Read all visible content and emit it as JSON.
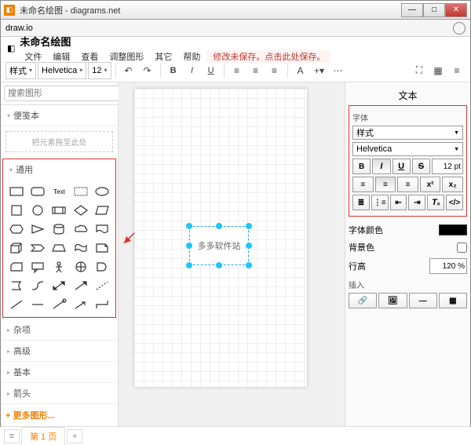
{
  "window": {
    "title": "未命名绘图 - diagrams.net",
    "app": "draw.io"
  },
  "doc": {
    "title": "未命名绘图"
  },
  "menu": {
    "file": "文件",
    "edit": "编辑",
    "view": "查看",
    "adjust": "调整图形",
    "other": "其它",
    "help": "帮助",
    "warn": "修改未保存。点击此处保存。"
  },
  "toolbar": {
    "style": "样式",
    "font": "Helvetica",
    "size": "12"
  },
  "sidebar": {
    "search_ph": "搜索图形",
    "scratch": "便笺本",
    "drag_hint": "把元素拖至此处",
    "general": "通用",
    "misc": "杂项",
    "advanced": "高级",
    "basic": "基本",
    "arrows": "箭头",
    "more": "+ 更多图形..."
  },
  "canvas": {
    "textbox": "多多软件站"
  },
  "rpanel": {
    "title": "文本",
    "font_label": "字体",
    "style_sel": "样式",
    "font_sel": "Helvetica",
    "size": "12 pt",
    "fontcolor": "字体颜色",
    "bgcolor": "背景色",
    "lineheight": "行高",
    "lineheight_val": "120 %",
    "insert": "插入"
  },
  "tabs": {
    "page1": "第 1 页"
  }
}
